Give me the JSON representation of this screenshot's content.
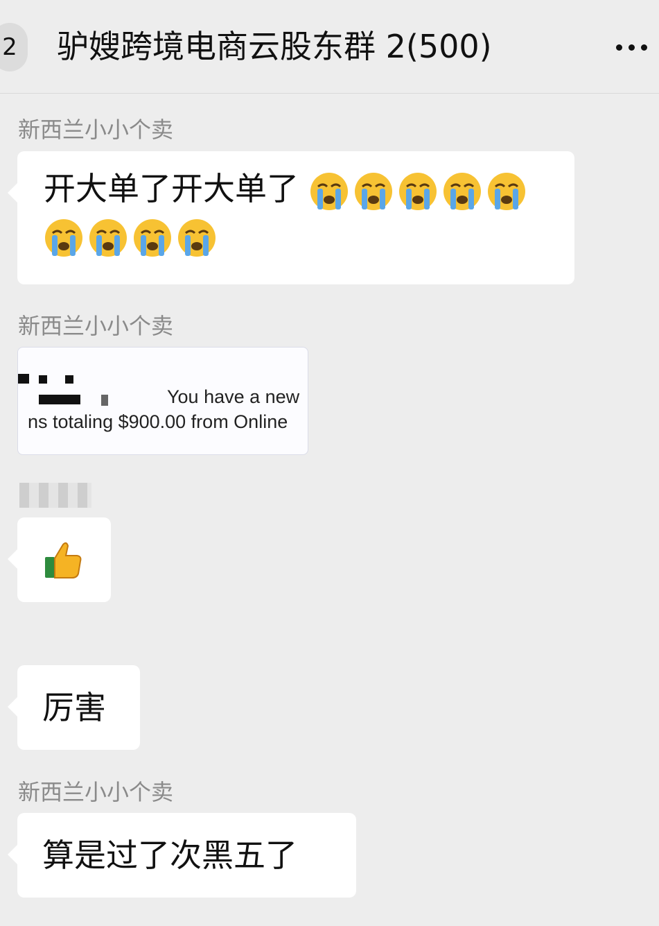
{
  "header": {
    "badge": "2",
    "title": "驴嫂跨境电商云股东群 2(500)",
    "more_icon": "more-dots-icon"
  },
  "messages": [
    {
      "sender": "新西兰小小个卖",
      "text": "开大单了开大单了",
      "emoji": "loudly-crying-face",
      "emoji_count": 9
    },
    {
      "sender": "新西兰小小个卖",
      "image": {
        "line1": "You have a new",
        "line2": "ns totaling $900.00 from Online"
      }
    },
    {
      "sender": "",
      "emoji": "thumbs-up"
    },
    {
      "text": "厉害"
    },
    {
      "sender": "新西兰小小个卖",
      "text": "算是过了次黑五了"
    }
  ],
  "colors": {
    "background": "#ededed",
    "bubble": "#ffffff",
    "sender_text": "#8a8a8a"
  }
}
